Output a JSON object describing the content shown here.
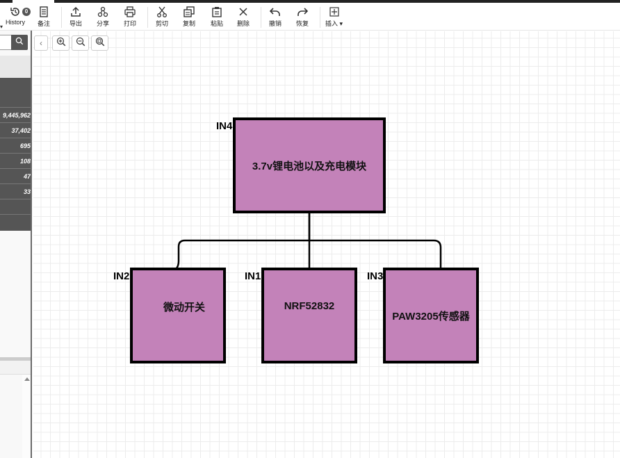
{
  "toolbar": {
    "history": {
      "label": "History",
      "badge": "0"
    },
    "items": [
      {
        "id": "notes",
        "label": "备注",
        "icon": "document-icon"
      },
      {
        "id": "export",
        "label": "导出",
        "icon": "upload-icon"
      },
      {
        "id": "share",
        "label": "分享",
        "icon": "share-icon"
      },
      {
        "id": "print",
        "label": "打印",
        "icon": "printer-icon"
      },
      {
        "id": "cut",
        "label": "剪切",
        "icon": "scissors-icon"
      },
      {
        "id": "copy",
        "label": "复制",
        "icon": "copy-icon"
      },
      {
        "id": "paste",
        "label": "粘贴",
        "icon": "clipboard-icon"
      },
      {
        "id": "delete",
        "label": "删除",
        "icon": "close-icon"
      },
      {
        "id": "undo",
        "label": "撤销",
        "icon": "undo-icon"
      },
      {
        "id": "redo",
        "label": "恢复",
        "icon": "redo-icon"
      },
      {
        "id": "insert",
        "label": "插入 ▾",
        "icon": "plus-square-icon"
      }
    ]
  },
  "sidebar": {
    "search_placeholder": "",
    "stats": [
      "9,445,962",
      "37,402",
      "695",
      "108",
      "47",
      "33",
      "",
      ""
    ]
  },
  "canvas_controls": {
    "collapse": "‹",
    "zoom_in": "zoom-in-icon",
    "zoom_out": "zoom-out-icon",
    "zoom_fit": "zoom-fit-icon"
  },
  "diagram": {
    "nodes": [
      {
        "id": "battery",
        "label": "3.7v锂电池以及充电模块",
        "port": "IN4"
      },
      {
        "id": "switch",
        "label": "微动开关",
        "port": "IN2"
      },
      {
        "id": "mcu",
        "label": "NRF52832",
        "port": "IN1"
      },
      {
        "id": "sensor",
        "label": "PAW3205传感器",
        "port": "IN3"
      }
    ],
    "edges": [
      {
        "from": "battery",
        "to": "switch"
      },
      {
        "from": "battery",
        "to": "mcu"
      },
      {
        "from": "battery",
        "to": "sensor"
      }
    ],
    "colors": {
      "node_fill": "#c382b9",
      "node_border": "#000000"
    }
  }
}
